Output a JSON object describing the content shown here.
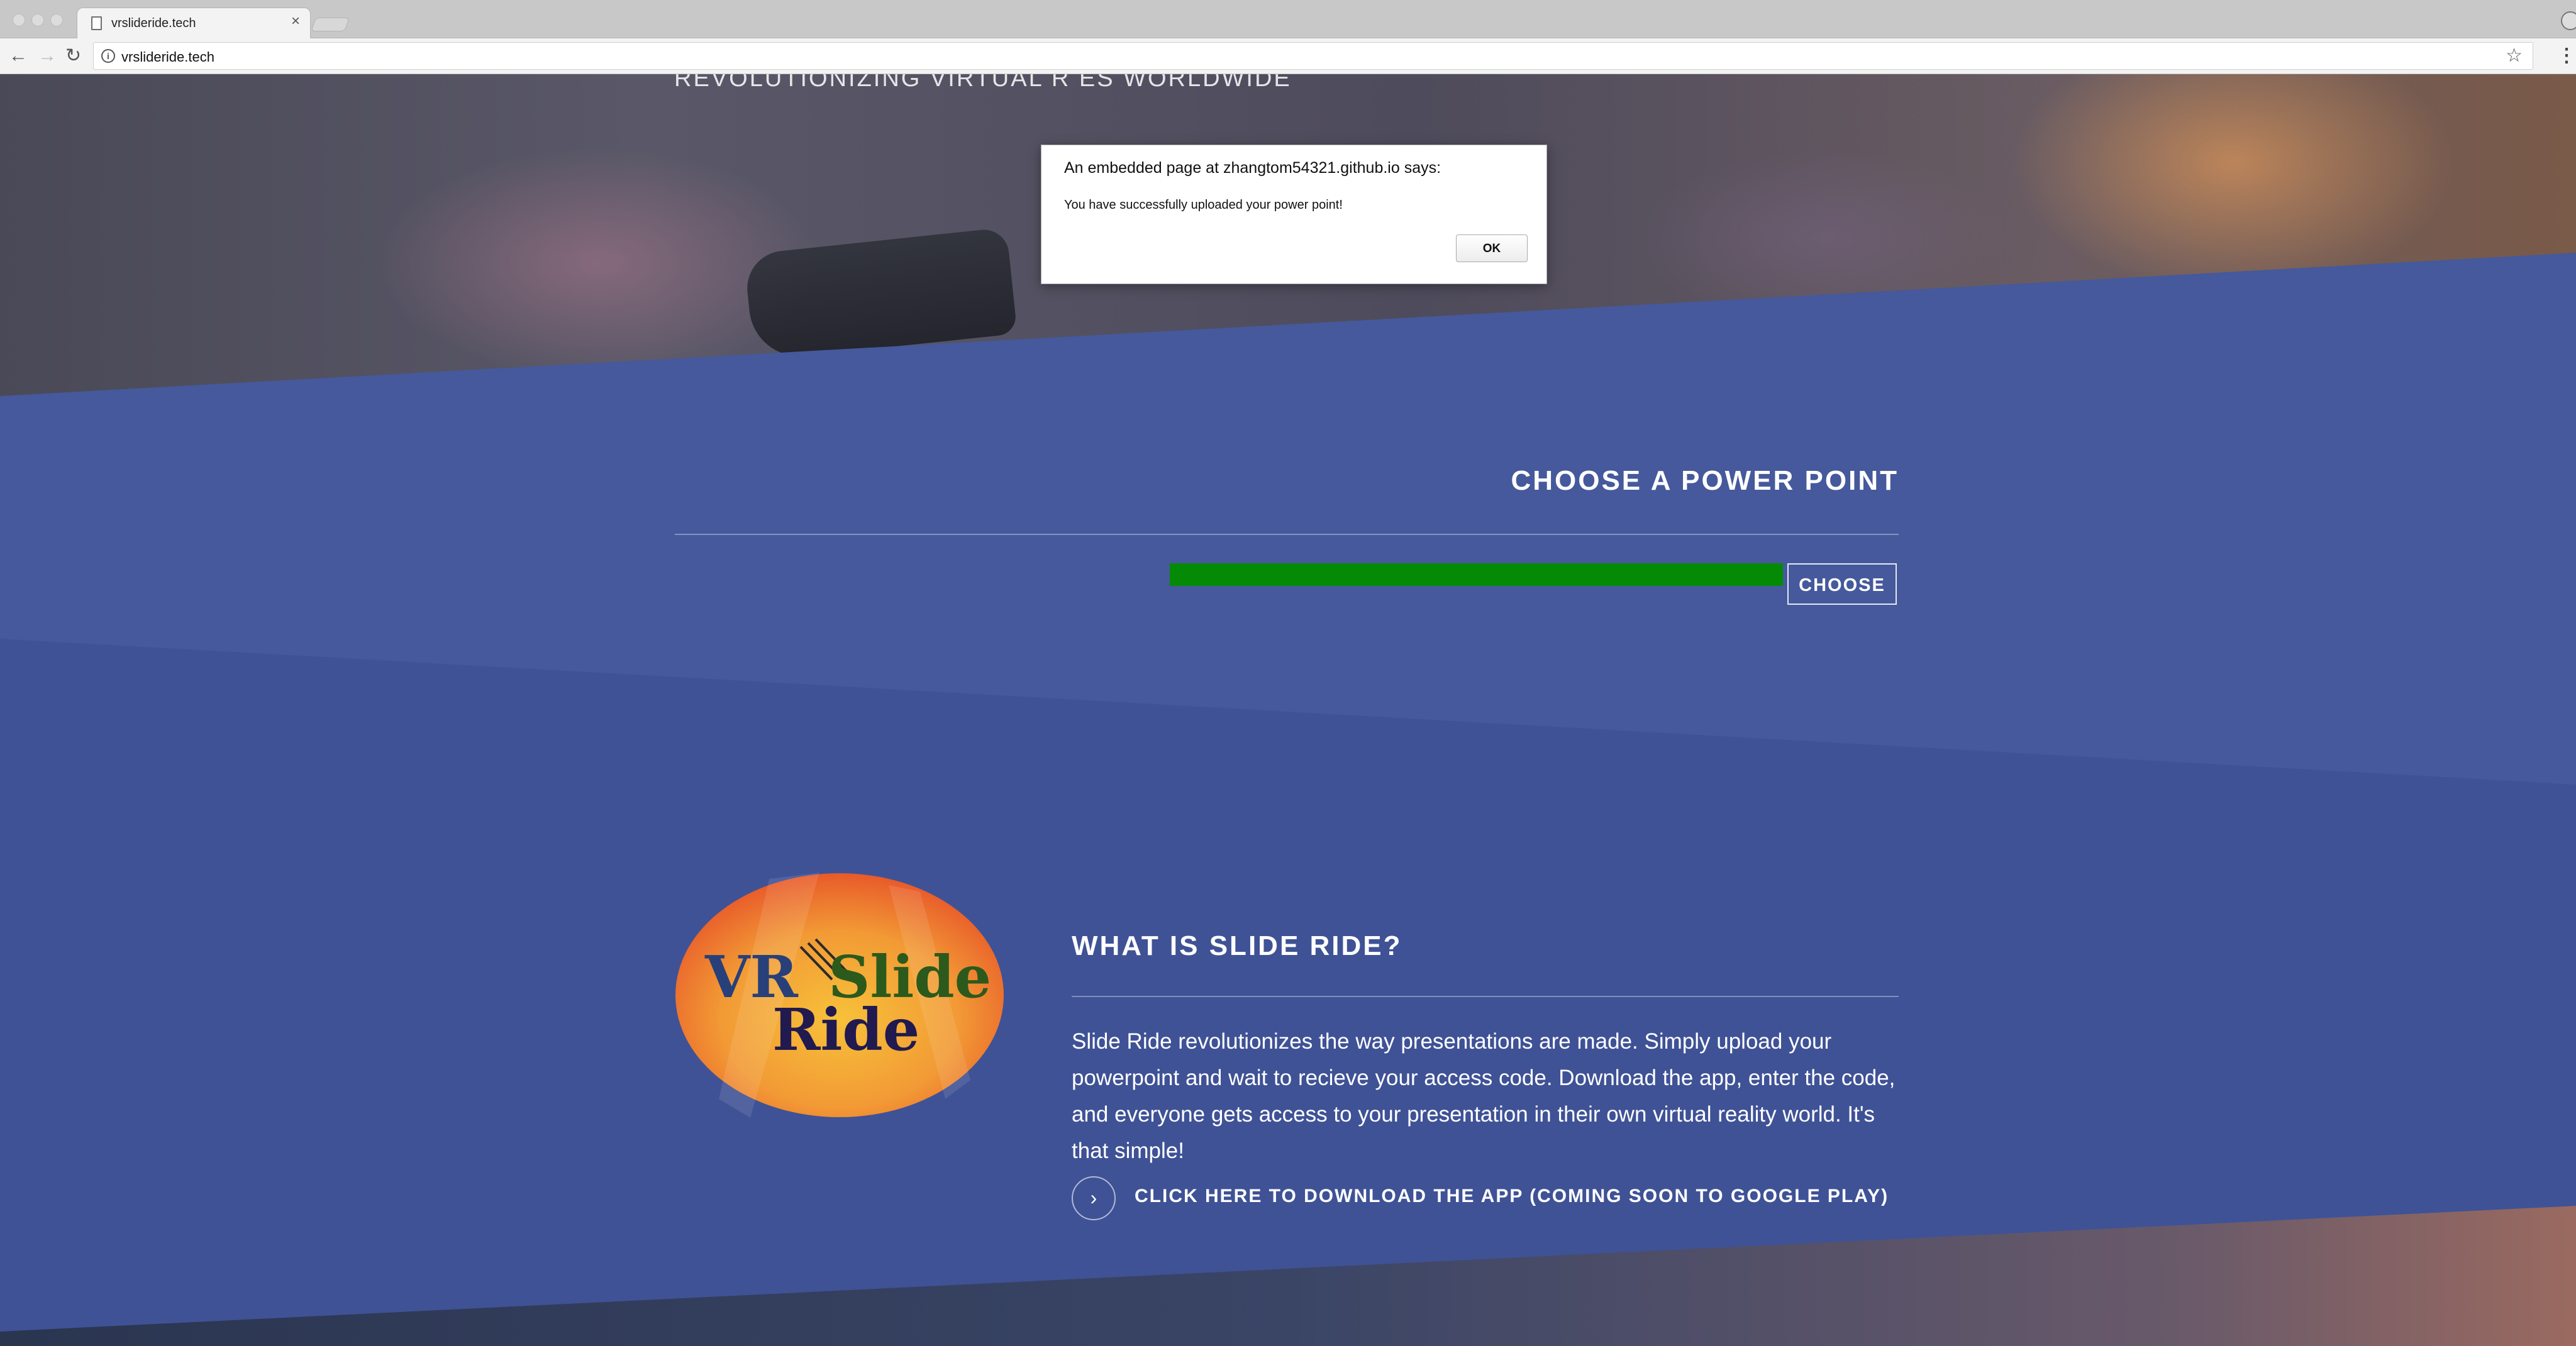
{
  "browser": {
    "tab_title": "vrslideride.tech",
    "tab_close": "×",
    "url": "vrslideride.tech",
    "icons": [
      "page-icon",
      "back-arrow-icon",
      "forward-arrow-icon",
      "reload-icon",
      "info-icon",
      "star-icon",
      "menu-icon",
      "profile-icon"
    ]
  },
  "hero": {
    "tagline": "REVOLUTIONIZING VIRTUAL R                                   ES WORLDWIDE"
  },
  "dialog": {
    "title": "An embedded page at zhangtom54321.github.io says:",
    "message": "You have successfully uploaded your power point!",
    "ok_label": "OK"
  },
  "upload": {
    "title": "CHOOSE A POWER POINT",
    "progress_percent": 100,
    "progress_color": "#058a06",
    "choose_label": "CHOOSE"
  },
  "about": {
    "logo_vr": "VR",
    "logo_slide": "Slide",
    "logo_ride": "Ride",
    "title": "WHAT IS SLIDE RIDE?",
    "body": "Slide Ride revolutionizes the way presentations are made. Simply upload your powerpoint and wait to recieve your access code. Download the app, enter the code, and everyone gets access to your presentation in their own virtual reality world. It's that simple!",
    "download_label": "CLICK HERE TO DOWNLOAD THE APP (COMING SOON TO GOOGLE PLAY)",
    "download_icon": "chevron-right-icon"
  },
  "colors": {
    "section_blue": "#45599c",
    "section_dark_blue": "#3f5296",
    "accent_green": "#058a06"
  }
}
